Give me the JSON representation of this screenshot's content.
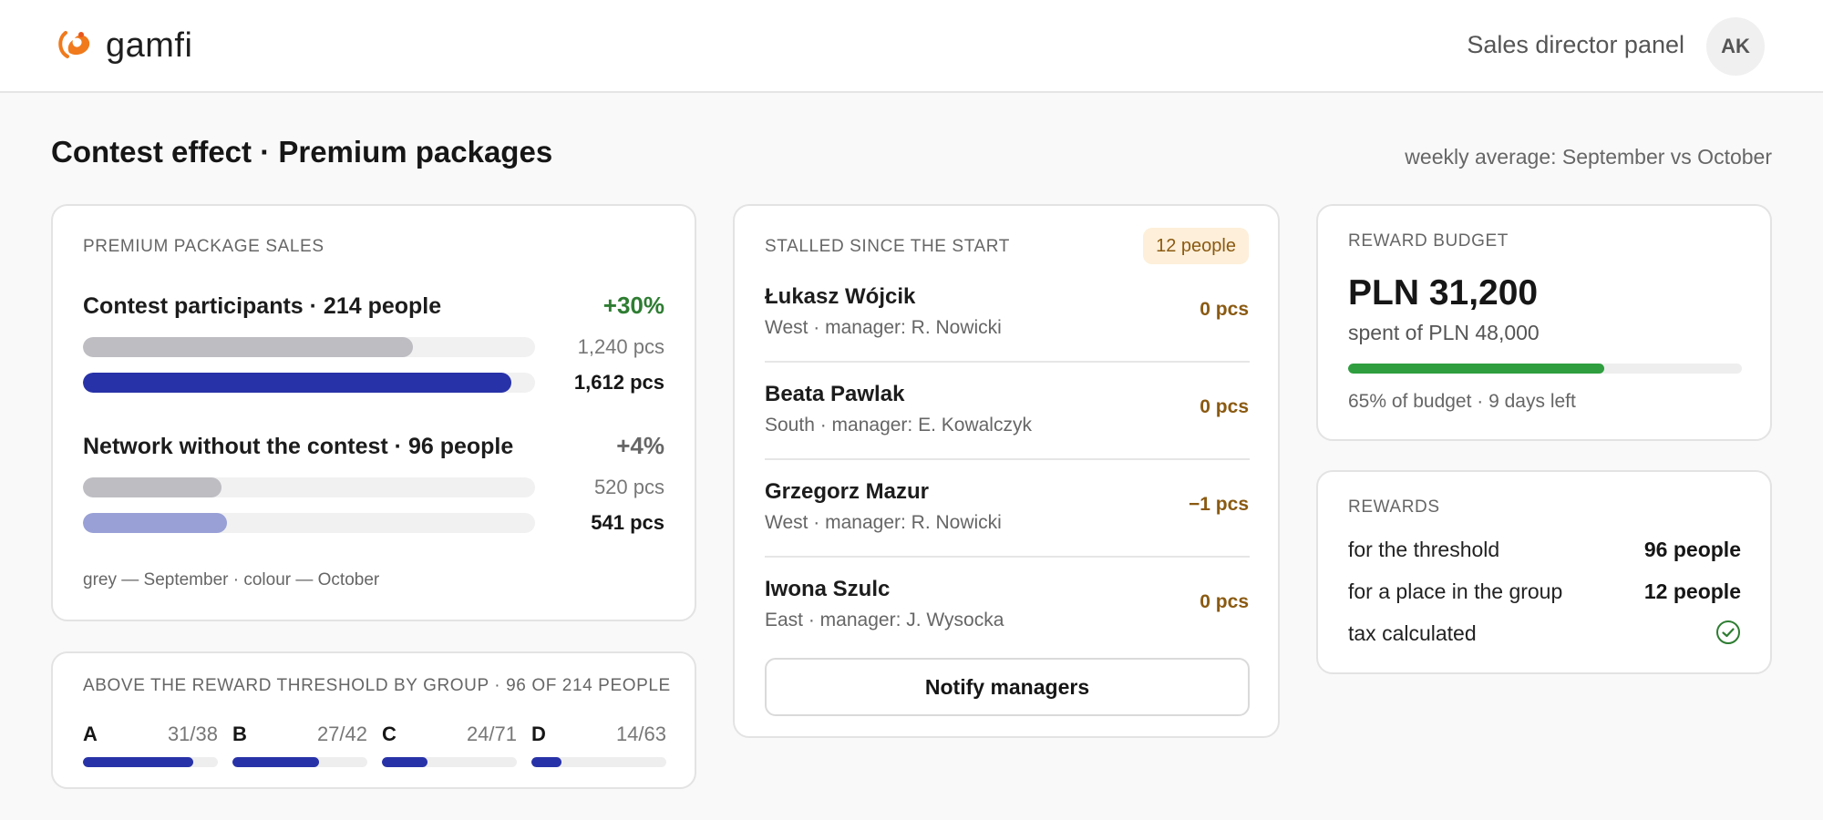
{
  "brand": {
    "name": "gamfi",
    "accent": "#f07a1c"
  },
  "header": {
    "panel_label": "Sales director panel",
    "avatar_initials": "AK"
  },
  "page": {
    "title": "Contest effect · Premium packages",
    "subtitle": "weekly average: September vs October"
  },
  "sales": {
    "caption": "PREMIUM PACKAGE SALES",
    "max_pcs": 1700,
    "groups": [
      {
        "label": "Contest participants · 214 people",
        "change": "+30%",
        "change_color": "#2e7d32",
        "september": {
          "value": 1240,
          "text": "1,240 pcs",
          "color": "#bdbdc2"
        },
        "october": {
          "value": 1612,
          "text": "1,612 pcs",
          "color": "#2832a8"
        }
      },
      {
        "label": "Network without the contest · 96 people",
        "change": "+4%",
        "change_color": "#666666",
        "september": {
          "value": 520,
          "text": "520 pcs",
          "color": "#bdbdc2"
        },
        "october": {
          "value": 541,
          "text": "541 pcs",
          "color": "#98a0d6"
        }
      }
    ],
    "legend": "grey — September · colour — October"
  },
  "threshold": {
    "caption": "ABOVE THE REWARD THRESHOLD BY GROUP · 96 OF 214 PEOPLE",
    "groups": [
      {
        "letter": "A",
        "ratio": "31/38",
        "above": 31,
        "total": 38
      },
      {
        "letter": "B",
        "ratio": "27/42",
        "above": 27,
        "total": 42
      },
      {
        "letter": "C",
        "ratio": "24/71",
        "above": 24,
        "total": 71
      },
      {
        "letter": "D",
        "ratio": "14/63",
        "above": 14,
        "total": 63
      }
    ],
    "color": "#2832a8"
  },
  "stalled": {
    "caption": "STALLED SINCE THE START",
    "badge": "12 people",
    "people": [
      {
        "name": "Łukasz Wójcik",
        "detail": "West · manager: R. Nowicki",
        "value": "0 pcs"
      },
      {
        "name": "Beata Pawlak",
        "detail": "South · manager: E. Kowalczyk",
        "value": "0 pcs"
      },
      {
        "name": "Grzegorz Mazur",
        "detail": "West · manager: R. Nowicki",
        "value": "−1 pcs"
      },
      {
        "name": "Iwona Szulc",
        "detail": "East · manager: J. Wysocka",
        "value": "0 pcs"
      }
    ],
    "button": "Notify managers"
  },
  "budget": {
    "caption": "REWARD BUDGET",
    "amount": "PLN 31,200",
    "of_text": "spent of PLN 48,000",
    "fraction": 0.65,
    "bar_color": "#2f9e3f",
    "note": "65% of budget · 9 days left"
  },
  "rewards": {
    "caption": "REWARDS",
    "rows": [
      {
        "label": "for the threshold",
        "value": "96 people"
      },
      {
        "label": "for a place in the group",
        "value": "12 people"
      },
      {
        "label": "tax calculated",
        "value": ""
      }
    ],
    "check_color": "#2e7d32"
  }
}
